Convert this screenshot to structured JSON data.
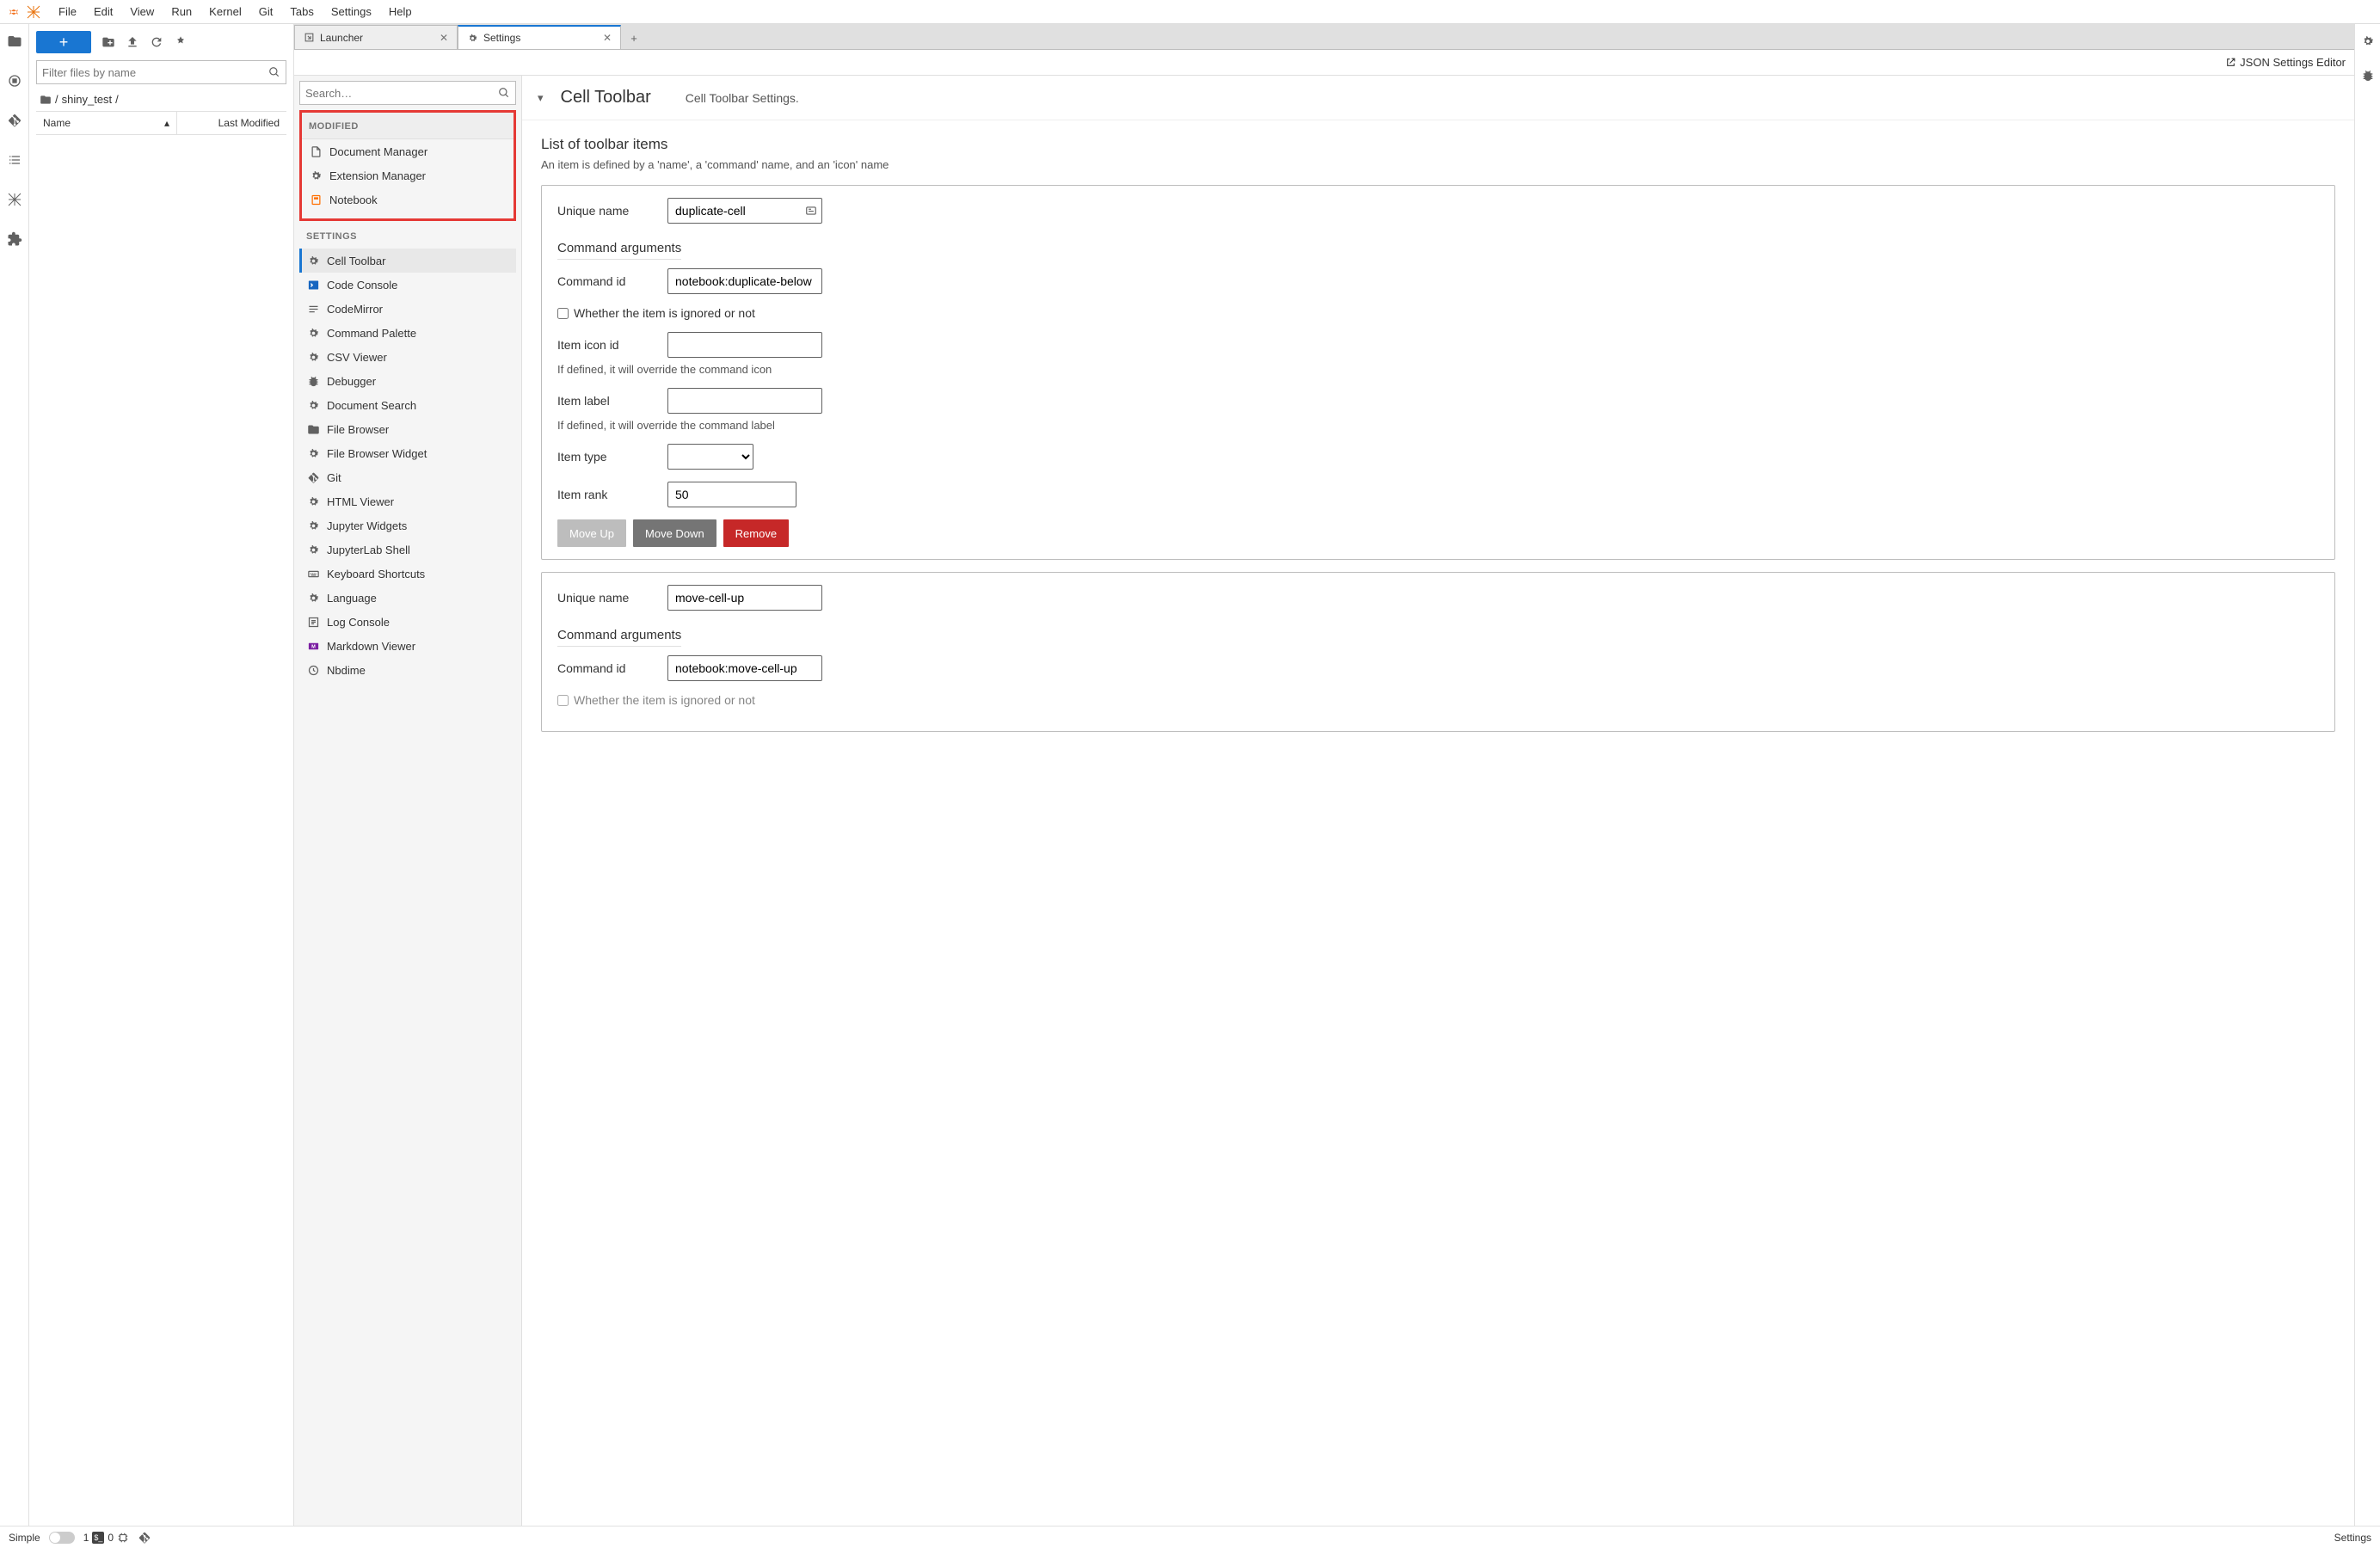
{
  "menubar": [
    "File",
    "Edit",
    "View",
    "Run",
    "Kernel",
    "Git",
    "Tabs",
    "Settings",
    "Help"
  ],
  "file_panel": {
    "filter_placeholder": "Filter files by name",
    "breadcrumb": [
      "/",
      "shiny_test",
      "/"
    ],
    "col_name": "Name",
    "col_modified": "Last Modified"
  },
  "dock": {
    "tabs": [
      {
        "label": "Launcher",
        "active": false
      },
      {
        "label": "Settings",
        "active": true
      }
    ],
    "json_editor": "JSON Settings Editor"
  },
  "settings_sidebar": {
    "search_placeholder": "Search…",
    "section_modified": "MODIFIED",
    "modified_items": [
      {
        "label": "Document Manager",
        "icon": "file"
      },
      {
        "label": "Extension Manager",
        "icon": "gear"
      },
      {
        "label": "Notebook",
        "icon": "notebook"
      }
    ],
    "section_settings": "SETTINGS",
    "settings_items": [
      {
        "label": "Cell Toolbar",
        "icon": "gear",
        "active": true
      },
      {
        "label": "Code Console",
        "icon": "console"
      },
      {
        "label": "CodeMirror",
        "icon": "lines"
      },
      {
        "label": "Command Palette",
        "icon": "gear"
      },
      {
        "label": "CSV Viewer",
        "icon": "gear"
      },
      {
        "label": "Debugger",
        "icon": "bug"
      },
      {
        "label": "Document Search",
        "icon": "gear"
      },
      {
        "label": "File Browser",
        "icon": "folder"
      },
      {
        "label": "File Browser Widget",
        "icon": "gear"
      },
      {
        "label": "Git",
        "icon": "git"
      },
      {
        "label": "HTML Viewer",
        "icon": "gear"
      },
      {
        "label": "Jupyter Widgets",
        "icon": "gear"
      },
      {
        "label": "JupyterLab Shell",
        "icon": "gear"
      },
      {
        "label": "Keyboard Shortcuts",
        "icon": "keyboard"
      },
      {
        "label": "Language",
        "icon": "gear"
      },
      {
        "label": "Log Console",
        "icon": "log"
      },
      {
        "label": "Markdown Viewer",
        "icon": "markdown"
      },
      {
        "label": "Nbdime",
        "icon": "clock"
      }
    ]
  },
  "settings_content": {
    "title": "Cell Toolbar",
    "desc": "Cell Toolbar Settings.",
    "list_title": "List of toolbar items",
    "list_sub": "An item is defined by a 'name', a 'command' name, and an 'icon' name",
    "labels": {
      "unique_name": "Unique name",
      "cmd_args": "Command arguments",
      "cmd_id": "Command id",
      "ignored": "Whether the item is ignored or not",
      "icon_id": "Item icon id",
      "icon_help": "If defined, it will override the command icon",
      "item_label": "Item label",
      "label_help": "If defined, it will override the command label",
      "item_type": "Item type",
      "item_rank": "Item rank",
      "move_up": "Move Up",
      "move_down": "Move Down",
      "remove": "Remove"
    },
    "items": [
      {
        "unique_name": "duplicate-cell",
        "command_id": "notebook:duplicate-below",
        "ignored": false,
        "icon_id": "",
        "item_label": "",
        "item_type": "",
        "item_rank": "50"
      },
      {
        "unique_name": "move-cell-up",
        "command_id": "notebook:move-cell-up",
        "ignored": false,
        "truncated_ignored_text": "Whether the item is ignored or not"
      }
    ]
  },
  "status": {
    "simple": "Simple",
    "term_count": "1",
    "kernel_count": "0",
    "right": "Settings"
  }
}
